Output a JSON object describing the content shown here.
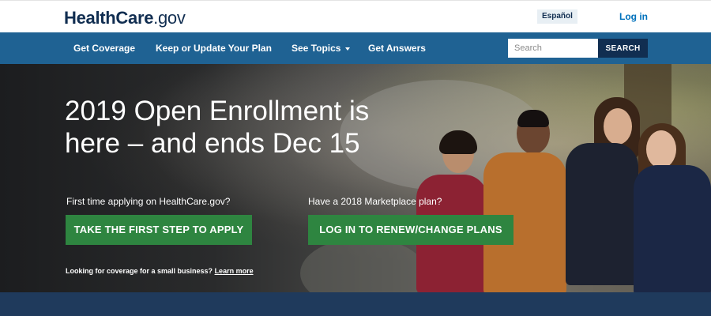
{
  "header": {
    "logo_bold": "HealthCare",
    "logo_light": ".gov",
    "language_label": "Español",
    "login_label": "Log in"
  },
  "nav": {
    "items": [
      {
        "label": "Get Coverage"
      },
      {
        "label": "Keep or Update Your Plan"
      },
      {
        "label": "See Topics"
      },
      {
        "label": "Get Answers"
      }
    ],
    "search_placeholder": "Search",
    "search_button": "SEARCH"
  },
  "hero": {
    "headline_line1": "2019 Open Enrollment is",
    "headline_line2": "here – and ends Dec 15",
    "left_prompt": "First time applying on HealthCare.gov?",
    "left_button": "TAKE THE FIRST STEP TO APPLY",
    "right_prompt": "Have a 2018 Marketplace plan?",
    "right_button": "LOG IN TO RENEW/CHANGE PLANS",
    "small_business_text": "Looking for coverage for a small business?",
    "small_business_link": "Learn more"
  },
  "colors": {
    "nav_bg": "#1f6293",
    "cta_green": "#2e8540",
    "brand_navy": "#112e51",
    "link_blue": "#0071bc"
  }
}
